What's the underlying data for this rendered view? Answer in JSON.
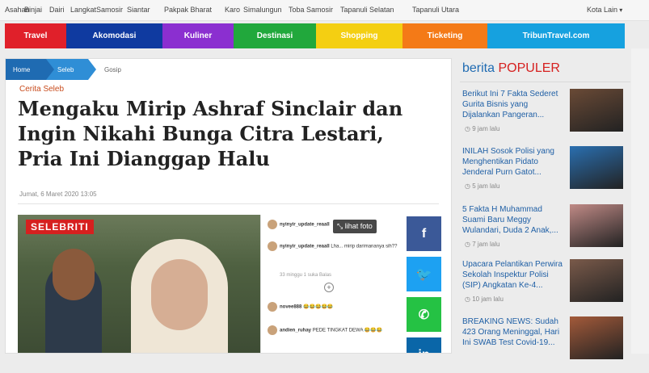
{
  "regions": [
    {
      "label": "Asahan",
      "more": false
    },
    {
      "label": "Binjai",
      "more": false
    },
    {
      "label": "Dairi",
      "more": false
    },
    {
      "label": "Langkat",
      "more": false
    },
    {
      "label": "Samosir",
      "more": false
    },
    {
      "label": "Siantar",
      "more": false
    },
    {
      "label": "Pakpak Bharat",
      "more": false
    },
    {
      "label": "Karo",
      "more": false
    },
    {
      "label": "Simalungun",
      "more": false
    },
    {
      "label": "Toba Samosir",
      "more": false
    },
    {
      "label": "Tapanuli Selatan",
      "more": false
    },
    {
      "label": "Tapanuli Utara",
      "more": false
    },
    {
      "label": "Kota Lain",
      "more": true
    }
  ],
  "categories": [
    {
      "label": "Travel",
      "color": "#e0202a"
    },
    {
      "label": "Akomodasi",
      "color": "#0f3aa0"
    },
    {
      "label": "Kuliner",
      "color": "#8b2fd0"
    },
    {
      "label": "Destinasi",
      "color": "#21a83c"
    },
    {
      "label": "Shopping",
      "color": "#f4cf12"
    },
    {
      "label": "Ticketing",
      "color": "#f47a17"
    },
    {
      "label": "TribunTravel.com",
      "color": "#16a1df"
    }
  ],
  "breadcrumb": {
    "home": "Home",
    "seleb": "Seleb",
    "current": "Gosip"
  },
  "article": {
    "kicker": "Cerita Seleb",
    "title": "Mengaku Mirip Ashraf Sinclair dan Ingin Nikahi Bunga Citra Lestari, Pria Ini Dianggap Halu",
    "date": "Jumat, 6 Maret 2020 13:05",
    "photo_label": "SELEBRITI",
    "view_photo": "lihat foto",
    "ig_comments": [
      {
        "user": "nyinyir_update_reaall",
        "text": ""
      },
      {
        "user": "nyinyir_update_reaall",
        "text": "Lha... mirip darimananya sih??"
      },
      {
        "user": "",
        "text": "33 minggu  1 suka  Balas"
      },
      {
        "user": "novee888",
        "text": "😂😂😂😂😂"
      },
      {
        "user": "andien_ruhay",
        "text": "PEDE TINGKAT DEWA 😂😂😂"
      }
    ]
  },
  "share": [
    {
      "icon": "facebook-icon",
      "glyph": "f",
      "color": "#3b5998"
    },
    {
      "icon": "twitter-icon",
      "glyph": "🐦",
      "color": "#1da1f2"
    },
    {
      "icon": "whatsapp-icon",
      "glyph": "✆",
      "color": "#25c244"
    },
    {
      "icon": "linkedin-icon",
      "glyph": "in",
      "color": "#0a66a8"
    }
  ],
  "sidebar": {
    "title_a": "berita",
    "title_b": "POPULER",
    "items": [
      {
        "text": "Berikut Ini 7 Fakta Sederet Gurita Bisnis yang Dijalankan Pangeran...",
        "time": "9 jam lalu",
        "thumb": "#6a4a36"
      },
      {
        "text": "INILAH Sosok Polisi yang Menghentikan Pidato Jenderal Purn Gatot...",
        "time": "5 jam lalu",
        "thumb": "#2a6fb0"
      },
      {
        "text": "5 Fakta H Muhammad Suami Baru Meggy Wulandari, Duda 2 Anak,...",
        "time": "7 jam lalu",
        "thumb": "#c08a86"
      },
      {
        "text": "Upacara Pelantikan Perwira Sekolah Inspektur Polisi (SIP) Angkatan Ke-4...",
        "time": "10 jam lalu",
        "thumb": "#7a5a4a"
      },
      {
        "text": "BREAKING NEWS: Sudah 423 Orang Meninggal, Hari Ini SWAB Test Covid-19...",
        "time": "",
        "thumb": "#a35a3a"
      }
    ]
  }
}
